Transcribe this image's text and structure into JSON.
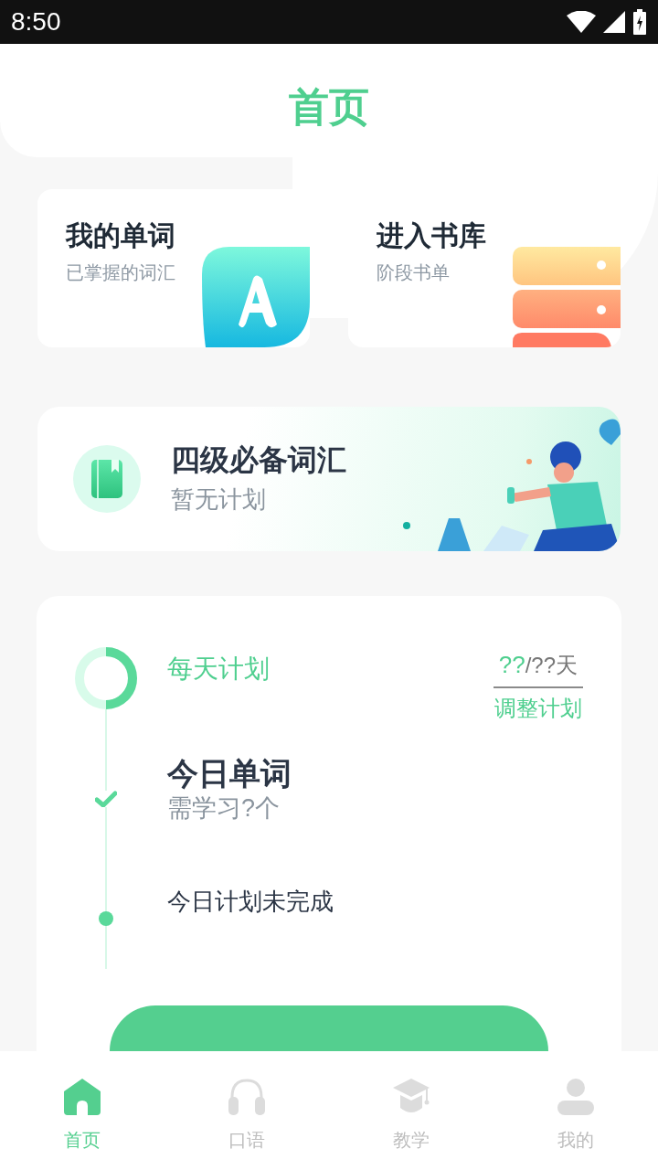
{
  "status_bar": {
    "time": "8:50"
  },
  "header": {
    "title": "首页"
  },
  "shortcut_cards": [
    {
      "kind": "words",
      "title": "我的单词",
      "subtitle": "已掌握的词汇"
    },
    {
      "kind": "library",
      "title": "进入书库",
      "subtitle": "阶段书单"
    }
  ],
  "wordbook": {
    "title": "四级必备词汇",
    "subtitle": "暂无计划"
  },
  "plan": {
    "label": "每天计划",
    "days_done": "??",
    "days_total": "/??天",
    "adjust_link": "调整计划",
    "steps": [
      {
        "kind": "check",
        "title": "今日单词",
        "subtitle": "需学习?个"
      },
      {
        "kind": "dot",
        "title": "今日计划未完成"
      }
    ]
  },
  "tab_bar": [
    {
      "kind": "home",
      "label": "首页",
      "selected": true
    },
    {
      "kind": "headphones",
      "label": "口语",
      "selected": false
    },
    {
      "kind": "graduation",
      "label": "教学",
      "selected": false
    },
    {
      "kind": "person",
      "label": "我的",
      "selected": false
    }
  ]
}
